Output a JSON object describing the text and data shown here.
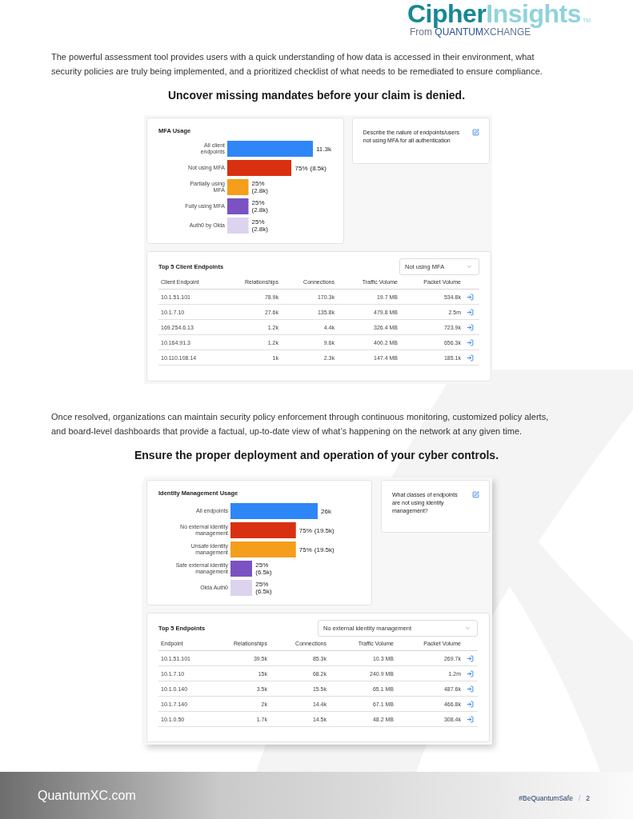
{
  "logo": {
    "name_a": "Cipher",
    "name_b": "Insights",
    "trademark": "TM",
    "tagline_from": "From",
    "tagline_brand_a": "QUANTUM",
    "tagline_brand_b": "XCHANGE"
  },
  "sections": [
    {
      "intro": "The powerful assessment tool provides users with a quick understanding of how data is accessed in their environment, what security policies are truly being implemented, and a prioritized checklist of what needs to be remediated to ensure compliance.",
      "heading": "Uncover missing mandates before your claim is denied.",
      "chart_card": {
        "chart_data": {
          "type": "bar",
          "orientation": "horizontal",
          "title": "MFA Usage",
          "categories": [
            "All client endpoints",
            "Not using MFA",
            "Partially using MFA",
            "Fully using MFA",
            "Auth0 by Okta"
          ],
          "values": [
            11.3,
            8.5,
            2.8,
            2.8,
            2.8
          ],
          "colors": [
            "#2f86f6",
            "#d93012",
            "#f59e1c",
            "#7b52c2",
            "#dcd3ee"
          ],
          "value_labels": [
            "11.3k",
            "(8.5k)",
            "(2.8k)",
            "(2.8k)",
            "(2.8k)"
          ],
          "annotations": [
            "75%",
            "25%",
            "25%",
            "25%"
          ]
        }
      },
      "note_card": {
        "text": "Describe the nature of endpoints/users not using MFA for all authentication"
      },
      "table_card": {
        "title": "Top 5 Client Endpoints",
        "filter": {
          "value": "Not using MFA"
        },
        "columns": [
          "Client Endpoint",
          "Relationships",
          "Connections",
          "Traffic Volume",
          "Packet Volume"
        ],
        "rows": [
          [
            "10.1.51.101",
            "78.9k",
            "170.3k",
            "19.7 MB",
            "534.8k"
          ],
          [
            "10.1.7.10",
            "27.6k",
            "135.8k",
            "479.8 MB",
            "2.5m"
          ],
          [
            "169.254.6.13",
            "1.2k",
            "4.4k",
            "326.4 MB",
            "723.9k"
          ],
          [
            "10.164.91.3",
            "1.2k",
            "9.6k",
            "400.2 MB",
            "656.3k"
          ],
          [
            "10.110.108.14",
            "1k",
            "2.3k",
            "147.4 MB",
            "185.1k"
          ]
        ]
      }
    },
    {
      "intro": "Once resolved, organizations can maintain security policy enforcement through continuous monitoring, customized policy alerts, and board-level dashboards that provide a factual, up-to-date view of what’s happening on the network at any given time.",
      "heading": "Ensure the proper deployment and operation of your cyber controls.",
      "chart_card": {
        "chart_data": {
          "type": "bar",
          "orientation": "horizontal",
          "title": "Identity Management Usage",
          "categories": [
            "All endpoints",
            "No external identity management",
            "Unsafe identity management",
            "Safe external identity management",
            "Okta Auth0"
          ],
          "values": [
            26,
            19.5,
            19.5,
            6.5,
            6.5
          ],
          "colors": [
            "#2f86f6",
            "#d93012",
            "#f59e1c",
            "#7b52c2",
            "#dcd3ee"
          ],
          "value_labels": [
            "26k",
            "(19.5k)",
            "(19.5k)",
            "(6.5k)",
            "(6.5k)"
          ],
          "annotations": [
            "75%",
            "75%",
            "25%",
            "25%"
          ]
        }
      },
      "note_card": {
        "text": "What classes of endpoints are not using identity management?"
      },
      "table_card": {
        "title": "Top 5 Endpoints",
        "filter": {
          "value": "No external identity management"
        },
        "columns": [
          "Endpoint",
          "Relationships",
          "Connections",
          "Traffic Volume",
          "Packet Volume"
        ],
        "rows": [
          [
            "10.1.51.101",
            "39.5k",
            "85.3k",
            "10.3 MB",
            "269.7k"
          ],
          [
            "10.1.7.10",
            "15k",
            "68.2k",
            "240.9 MB",
            "1.2m"
          ],
          [
            "10.1.0.140",
            "3.5k",
            "15.5k",
            "65.1 MB",
            "487.6k"
          ],
          [
            "10.1.7.140",
            "2k",
            "14.4k",
            "67.1 MB",
            "466.8k"
          ],
          [
            "10.1.0.50",
            "1.7k",
            "14.5k",
            "48.2 MB",
            "308.4k"
          ]
        ]
      }
    }
  ],
  "footer": {
    "site": "QuantumXC.com",
    "hashtag": "#BeQuantumSafe",
    "separator": "/",
    "page": "2"
  }
}
